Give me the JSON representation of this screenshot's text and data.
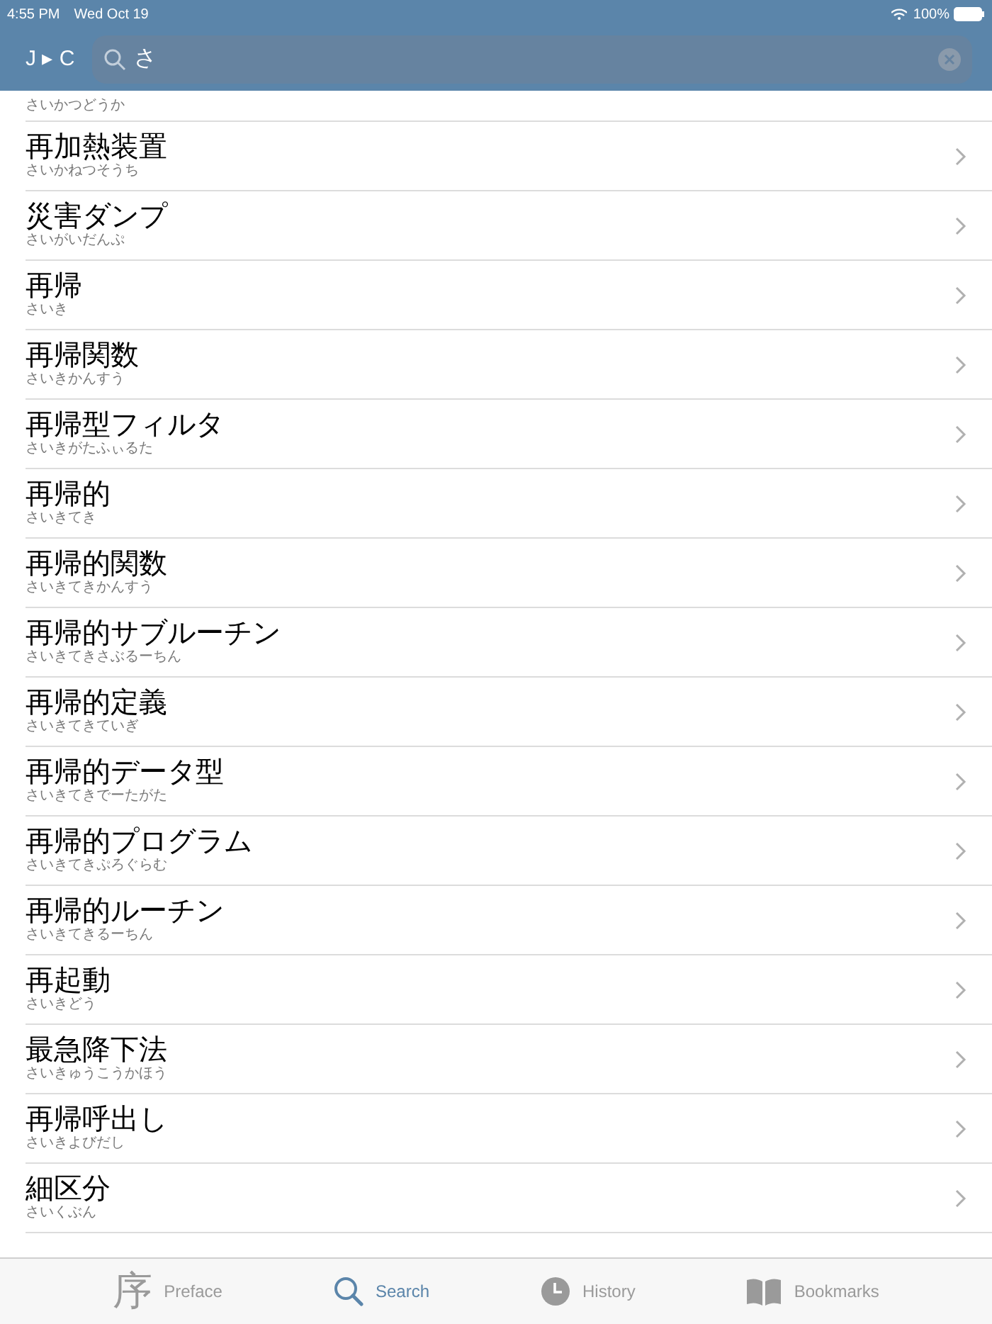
{
  "status_bar": {
    "time": "4:55 PM",
    "date": "Wed Oct 19",
    "battery": "100%"
  },
  "header": {
    "direction": "J ▸ C",
    "search_value": "さ"
  },
  "entries": [
    {
      "reading": "さいかつどうか"
    },
    {
      "word": "再加熱装置",
      "reading": "さいかねつそうち"
    },
    {
      "word": "災害ダンプ",
      "reading": "さいがいだんぷ"
    },
    {
      "word": "再帰",
      "reading": "さいき"
    },
    {
      "word": "再帰関数",
      "reading": "さいきかんすう"
    },
    {
      "word": "再帰型フィルタ",
      "reading": "さいきがたふぃるた"
    },
    {
      "word": "再帰的",
      "reading": "さいきてき"
    },
    {
      "word": "再帰的関数",
      "reading": "さいきてきかんすう"
    },
    {
      "word": "再帰的サブルーチン",
      "reading": "さいきてきさぶるーちん"
    },
    {
      "word": "再帰的定義",
      "reading": "さいきてきていぎ"
    },
    {
      "word": "再帰的データ型",
      "reading": "さいきてきでーたがた"
    },
    {
      "word": "再帰的プログラム",
      "reading": "さいきてきぷろぐらむ"
    },
    {
      "word": "再帰的ルーチン",
      "reading": "さいきてきるーちん"
    },
    {
      "word": "再起動",
      "reading": "さいきどう"
    },
    {
      "word": "最急降下法",
      "reading": "さいきゅうこうかほう"
    },
    {
      "word": "再帰呼出し",
      "reading": "さいきよびだし"
    },
    {
      "word": "細区分",
      "reading": "さいくぶん"
    }
  ],
  "tabs": [
    {
      "kind": "glyph",
      "glyph": "序",
      "label": "Preface",
      "selected": false
    },
    {
      "kind": "search",
      "label": "Search",
      "selected": true
    },
    {
      "kind": "clock",
      "label": "History",
      "selected": false
    },
    {
      "kind": "book",
      "label": "Bookmarks",
      "selected": false
    }
  ]
}
